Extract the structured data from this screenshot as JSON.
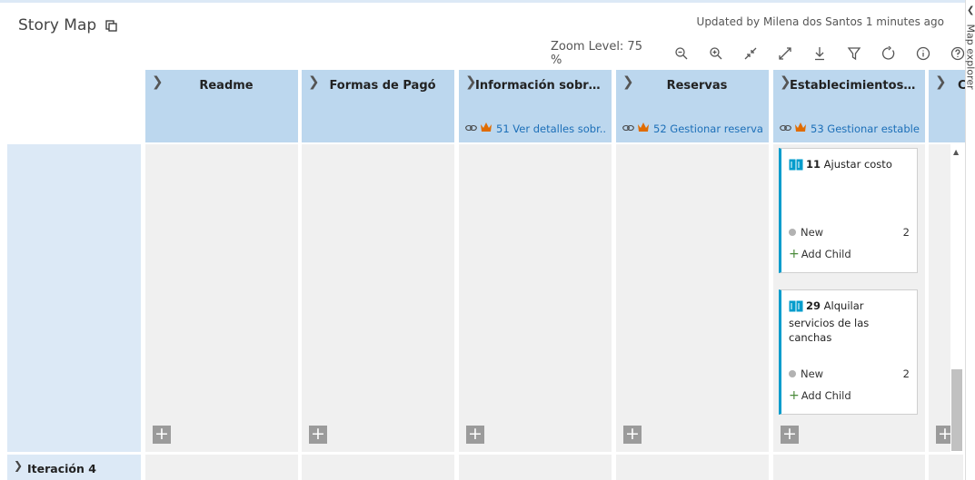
{
  "app": {
    "title": "Story Map",
    "updated_text": "Updated by Milena dos Santos 1 minutes ago"
  },
  "toolbar": {
    "zoom_label": "Zoom Level: 75 %",
    "icons": [
      "zoom-out-icon",
      "zoom-in-icon",
      "collapse-icon",
      "expand-icon",
      "download-icon",
      "filter-icon",
      "refresh-icon",
      "info-icon",
      "help-icon"
    ]
  },
  "side_panel": {
    "label": "Map explorer"
  },
  "columns": [
    {
      "title": "Readme",
      "link": ""
    },
    {
      "title": "Formas de Pagó",
      "link": ""
    },
    {
      "title": "Información sobre c...",
      "link": "51 Ver detalles sobr..."
    },
    {
      "title": "Reservas",
      "link": "52 Gestionar reserva..."
    },
    {
      "title": "Establecimientos ofr...",
      "link": "53 Gestionar estable..."
    },
    {
      "title": "C",
      "link": ""
    }
  ],
  "cards": [
    {
      "id": "11",
      "title": "Ajustar costo",
      "state": "New",
      "count": "2",
      "add_child": "Add Child"
    },
    {
      "id": "29",
      "title": "Alquilar servicios de las canchas",
      "state": "New",
      "count": "2",
      "add_child": "Add Child"
    }
  ],
  "iterations": [
    {
      "label": "Iteración 4"
    }
  ],
  "colors": {
    "header_bg": "#bcd7ee",
    "row_bg": "#dce9f6",
    "card_accent": "#009ccc",
    "link": "#1c6fb8",
    "crown": "#e06c00"
  }
}
